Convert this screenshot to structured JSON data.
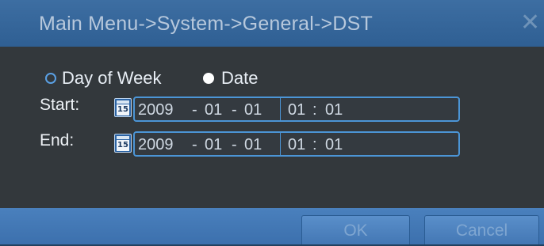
{
  "dialog": {
    "title": "Main Menu->System->General->DST",
    "close_icon": "close-icon"
  },
  "mode": {
    "options": [
      {
        "label": "Day of Week",
        "selected": false
      },
      {
        "label": "Date",
        "selected": true
      }
    ]
  },
  "start": {
    "label": "Start:",
    "year": "2009",
    "month": "01",
    "day": "01",
    "hour": "01",
    "minute": "01",
    "icon": "calendar-icon",
    "icon_text": "15"
  },
  "end": {
    "label": "End:",
    "year": "2009",
    "month": "01",
    "day": "01",
    "hour": "01",
    "minute": "01",
    "icon": "calendar-icon",
    "icon_text": "15"
  },
  "buttons": {
    "ok": "OK",
    "cancel": "Cancel"
  },
  "separators": {
    "date": "-",
    "time": ":"
  },
  "colors": {
    "title_bar": "#3d6ea2",
    "content_bg": "#33383c",
    "field_border": "#4b95d6",
    "footer": "#4a80bd"
  }
}
